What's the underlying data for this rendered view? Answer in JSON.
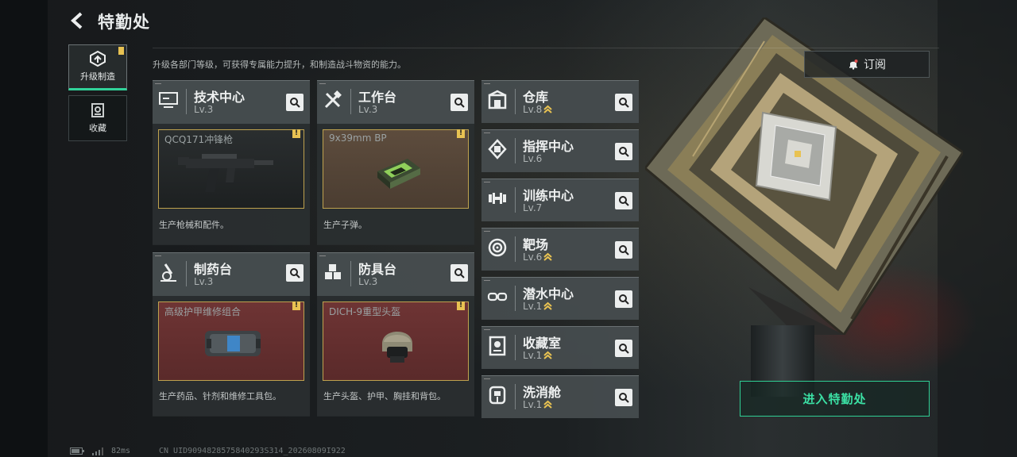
{
  "header": {
    "title": "特勤处"
  },
  "subtitle": "升级各部门等级，可获得专属能力提升，和制造战斗物资的能力。",
  "side_tabs": [
    {
      "label": "升级制造",
      "active": true,
      "badge": true
    },
    {
      "label": "收藏",
      "active": false,
      "badge": false
    }
  ],
  "big_cards": [
    {
      "name": "技术中心",
      "level": "Lv.3",
      "product": "QCQ171冲锋枪",
      "desc": "生产枪械和配件。",
      "badge": "!"
    },
    {
      "name": "工作台",
      "level": "Lv.3",
      "product": "9x39mm BP",
      "desc": "生产子弹。",
      "badge": "!"
    },
    {
      "name": "制药台",
      "level": "Lv.3",
      "product": "高级护甲维修组合",
      "desc": "生产药品、针剂和维修工具包。",
      "badge": "!"
    },
    {
      "name": "防具台",
      "level": "Lv.3",
      "product": "DICH-9重型头盔",
      "desc": "生产头盔、护甲、胸挂和背包。",
      "badge": "!"
    }
  ],
  "small_cards": [
    {
      "name": "仓库",
      "level": "Lv.8",
      "upgradable": true,
      "icon": "warehouse-icon"
    },
    {
      "name": "指挥中心",
      "level": "Lv.6",
      "upgradable": false,
      "icon": "command-chip-icon"
    },
    {
      "name": "训练中心",
      "level": "Lv.7",
      "upgradable": false,
      "icon": "dumbbell-icon"
    },
    {
      "name": "靶场",
      "level": "Lv.6",
      "upgradable": true,
      "icon": "target-icon"
    },
    {
      "name": "潜水中心",
      "level": "Lv.1",
      "upgradable": true,
      "icon": "diving-goggles-icon"
    },
    {
      "name": "收藏室",
      "level": "Lv.1",
      "upgradable": true,
      "icon": "trophy-case-icon"
    },
    {
      "name": "洗消舱",
      "level": "Lv.1",
      "upgradable": true,
      "icon": "decon-suit-icon"
    }
  ],
  "subscribe_label": "订阅",
  "enter_label": "进入特勤处",
  "footer": {
    "ping": "82ms",
    "uid": "CN UID9094828575840293S314_20260809I922"
  },
  "colors": {
    "accent_green": "#31d39a",
    "badge_yellow": "#e8c252",
    "product_bg_red": "#6b2e2e",
    "product_bg_brown": "#5a4a3a"
  }
}
